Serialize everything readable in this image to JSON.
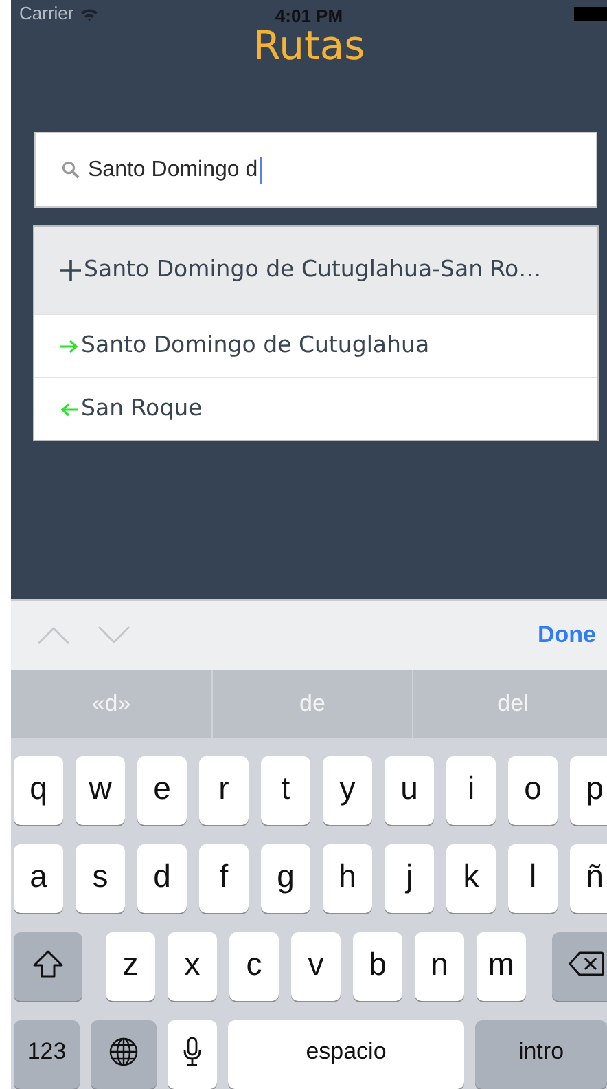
{
  "status_bar": {
    "carrier": "Carrier",
    "time": "4:01 PM"
  },
  "title": "Rutas",
  "search": {
    "value": "Santo Domingo d"
  },
  "suggestions": [
    {
      "kind": "add",
      "text": "Santo Domingo de Cutuglahua-San Ro…",
      "selected": true
    },
    {
      "kind": "origin",
      "text": "Santo Domingo de Cutuglahua",
      "selected": false
    },
    {
      "kind": "destination",
      "text": "San Roque",
      "selected": false
    }
  ],
  "keyboard_toolbar": {
    "done": "Done"
  },
  "predictions": [
    "«d»",
    "de",
    "del"
  ],
  "keyboard_rows": [
    [
      {
        "kind": "letter",
        "label": "q"
      },
      {
        "kind": "letter",
        "label": "w"
      },
      {
        "kind": "letter",
        "label": "e"
      },
      {
        "kind": "letter",
        "label": "r"
      },
      {
        "kind": "letter",
        "label": "t"
      },
      {
        "kind": "letter",
        "label": "y"
      },
      {
        "kind": "letter",
        "label": "u"
      },
      {
        "kind": "letter",
        "label": "i"
      },
      {
        "kind": "letter",
        "label": "o"
      },
      {
        "kind": "letter",
        "label": "p"
      }
    ],
    [
      {
        "kind": "letter",
        "label": "a"
      },
      {
        "kind": "letter",
        "label": "s"
      },
      {
        "kind": "letter",
        "label": "d"
      },
      {
        "kind": "letter",
        "label": "f"
      },
      {
        "kind": "letter",
        "label": "g"
      },
      {
        "kind": "letter",
        "label": "h"
      },
      {
        "kind": "letter",
        "label": "j"
      },
      {
        "kind": "letter",
        "label": "k"
      },
      {
        "kind": "letter",
        "label": "l"
      },
      {
        "kind": "letter",
        "label": "ñ"
      }
    ],
    [
      {
        "kind": "shift"
      },
      {
        "kind": "letter",
        "label": "z"
      },
      {
        "kind": "letter",
        "label": "x"
      },
      {
        "kind": "letter",
        "label": "c"
      },
      {
        "kind": "letter",
        "label": "v"
      },
      {
        "kind": "letter",
        "label": "b"
      },
      {
        "kind": "letter",
        "label": "n"
      },
      {
        "kind": "letter",
        "label": "m"
      },
      {
        "kind": "backspace"
      }
    ],
    [
      {
        "kind": "numbers",
        "label": "123"
      },
      {
        "kind": "globe"
      },
      {
        "kind": "mic"
      },
      {
        "kind": "space",
        "label": "espacio"
      },
      {
        "kind": "return",
        "label": "intro"
      }
    ]
  ]
}
